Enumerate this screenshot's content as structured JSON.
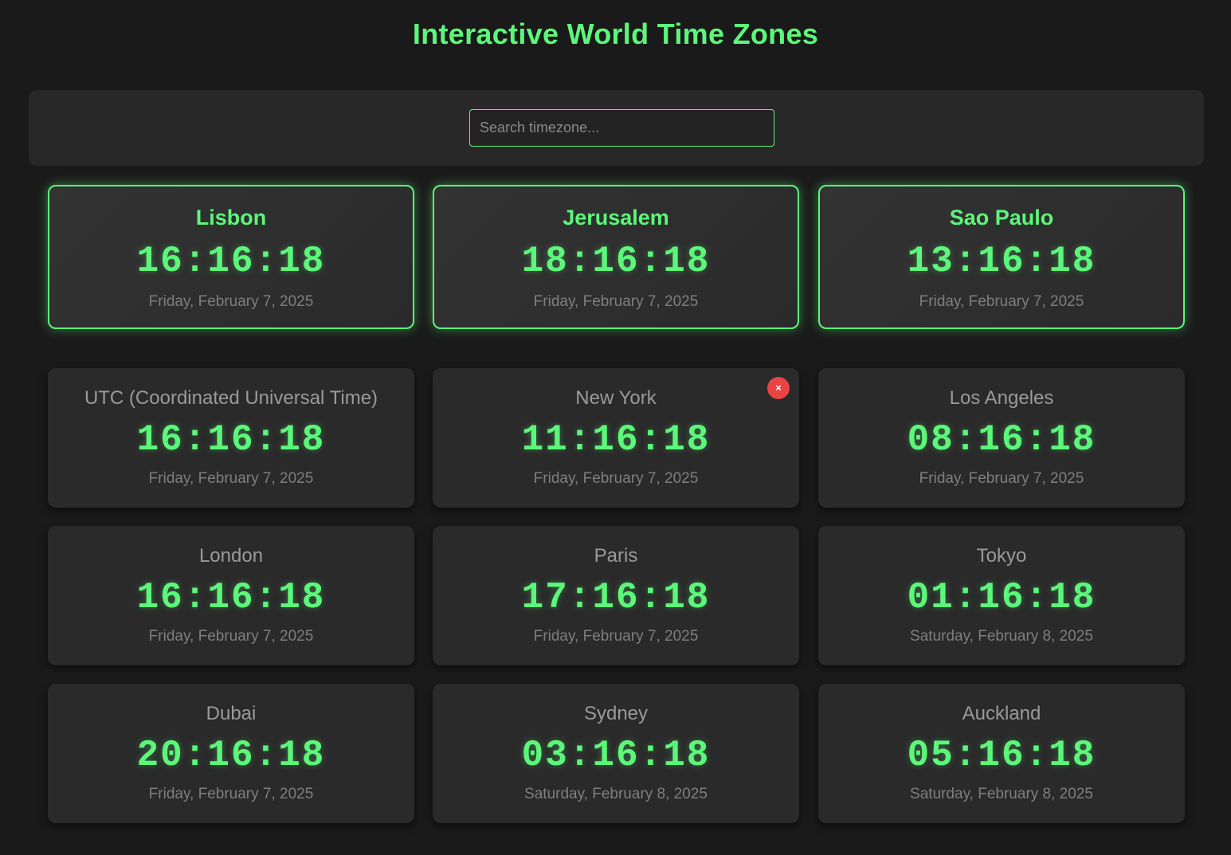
{
  "header": {
    "title": "Interactive World Time Zones"
  },
  "search": {
    "placeholder": "Search timezone...",
    "value": ""
  },
  "favorites": [
    {
      "city": "Lisbon",
      "time": "16:16:18",
      "date": "Friday, February 7, 2025"
    },
    {
      "city": "Jerusalem",
      "time": "18:16:18",
      "date": "Friday, February 7, 2025"
    },
    {
      "city": "Sao Paulo",
      "time": "13:16:18",
      "date": "Friday, February 7, 2025"
    }
  ],
  "clocks": [
    {
      "city": "UTC (Coordinated Universal Time)",
      "time": "16:16:18",
      "date": "Friday, February 7, 2025"
    },
    {
      "city": "New York",
      "time": "11:16:18",
      "date": "Friday, February 7, 2025",
      "remove_label": "×"
    },
    {
      "city": "Los Angeles",
      "time": "08:16:18",
      "date": "Friday, February 7, 2025"
    },
    {
      "city": "London",
      "time": "16:16:18",
      "date": "Friday, February 7, 2025"
    },
    {
      "city": "Paris",
      "time": "17:16:18",
      "date": "Friday, February 7, 2025"
    },
    {
      "city": "Tokyo",
      "time": "01:16:18",
      "date": "Saturday, February 8, 2025"
    },
    {
      "city": "Dubai",
      "time": "20:16:18",
      "date": "Friday, February 7, 2025"
    },
    {
      "city": "Sydney",
      "time": "03:16:18",
      "date": "Saturday, February 8, 2025"
    },
    {
      "city": "Auckland",
      "time": "05:16:18",
      "date": "Saturday, February 8, 2025"
    }
  ],
  "colors": {
    "accent": "#5cf77a",
    "background": "#1a1a1a",
    "card": "#2a2a2a",
    "remove": "#e94444"
  }
}
